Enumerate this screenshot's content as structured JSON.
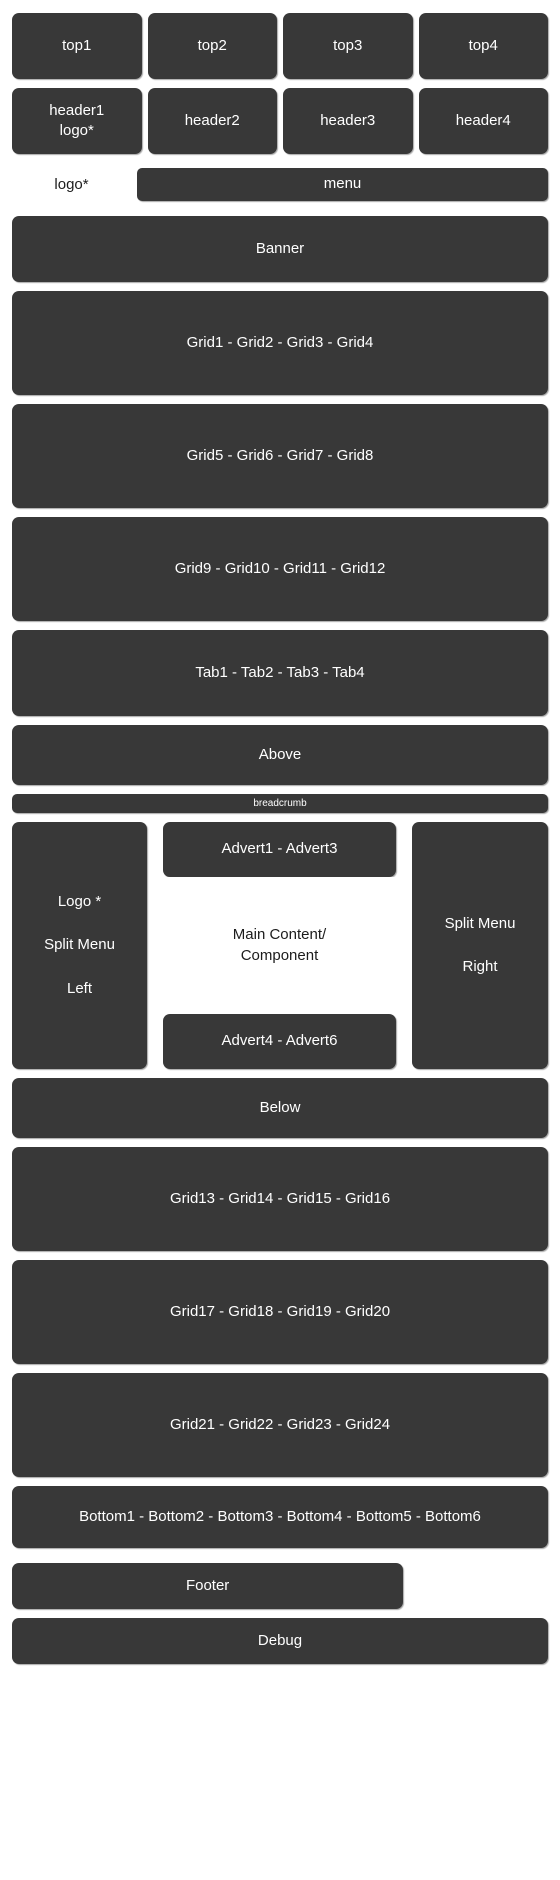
{
  "layout": {
    "accent_block_color": "#383838",
    "page_background": "#ffffff",
    "block_text_color": "#ffffff"
  },
  "top_row": {
    "blocks": [
      {
        "label": "top1"
      },
      {
        "label": "top2"
      },
      {
        "label": "top3"
      },
      {
        "label": "top4"
      }
    ]
  },
  "header_row": {
    "blocks": [
      {
        "label": "header1\nlogo*"
      },
      {
        "label": "header2"
      },
      {
        "label": "header3"
      },
      {
        "label": "header4"
      }
    ]
  },
  "logo_menu_row": {
    "logo_label": "logo*",
    "menu_label": "menu"
  },
  "banner": {
    "label": "Banner"
  },
  "grid_rows": [
    {
      "label": "Grid1 - Grid2 - Grid3 - Grid4"
    },
    {
      "label": "Grid5 - Grid6 - Grid7 - Grid8"
    },
    {
      "label": "Grid9 - Grid10 - Grid11 - Grid12"
    }
  ],
  "tabs": {
    "label": "Tab1 - Tab2 - Tab3 - Tab4"
  },
  "above": {
    "label": "Above"
  },
  "breadcrumb": {
    "label": "breadcrumb"
  },
  "main": {
    "left_sidebar": {
      "line1": "Logo *",
      "line2": "Split Menu",
      "line3": "Left"
    },
    "advert_top": {
      "label": "Advert1 - Advert3"
    },
    "content": {
      "line1": "Main Content/",
      "line2": "Component"
    },
    "advert_bottom": {
      "label": "Advert4 - Advert6"
    },
    "right_sidebar": {
      "line1": "Split Menu",
      "line2": "Right"
    }
  },
  "below": {
    "label": "Below"
  },
  "grid_rows_lower": [
    {
      "label": "Grid13 - Grid14 - Grid15 - Grid16"
    },
    {
      "label": "Grid17 - Grid18 - Grid19 - Grid20"
    },
    {
      "label": "Grid21 - Grid22 - Grid23 - Grid24"
    }
  ],
  "bottom": {
    "label": "Bottom1 - Bottom2 - Bottom3 - Bottom4 - Bottom5 - Bottom6"
  },
  "footer": {
    "label": "Footer"
  },
  "debug": {
    "label": "Debug"
  }
}
